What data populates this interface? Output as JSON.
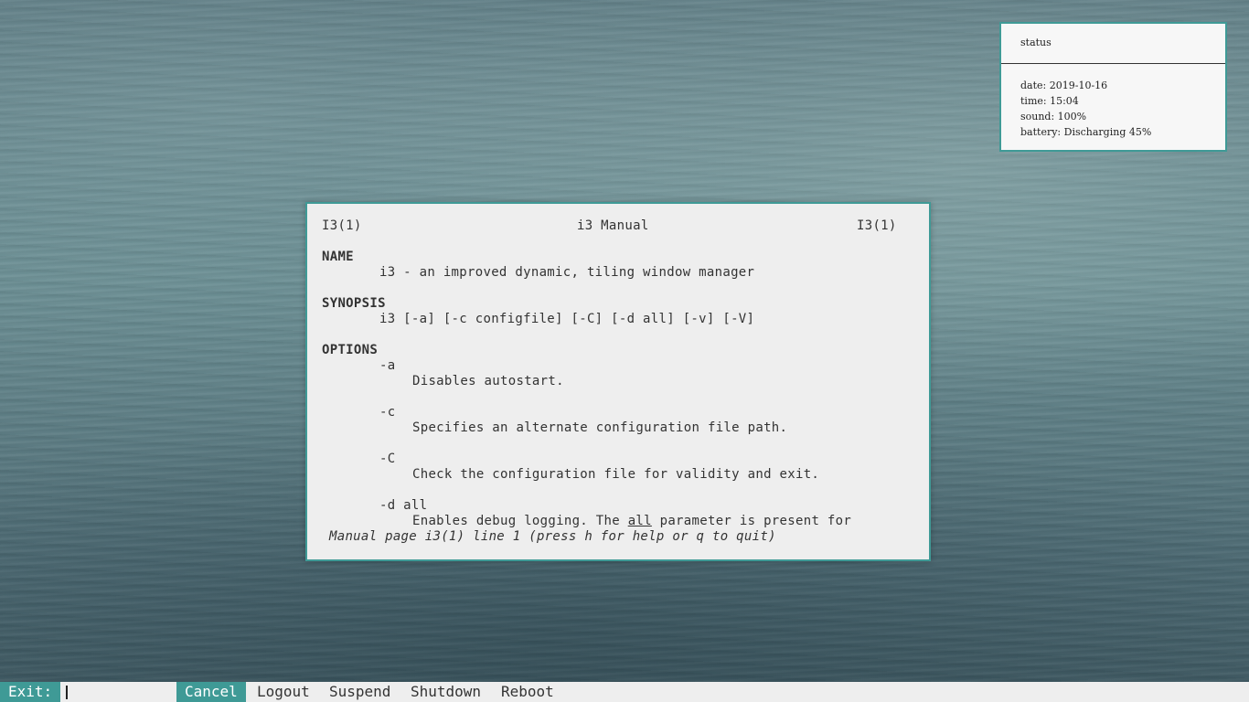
{
  "status": {
    "title": "status",
    "lines": [
      "date: 2019-10-16",
      "time: 15:04",
      "sound: 100%",
      "battery: Discharging 45%"
    ]
  },
  "manual": {
    "header_left": "I3(1)",
    "header_center": "i3 Manual",
    "header_right": "I3(1)",
    "name_heading": "NAME",
    "name_text": "i3 - an improved dynamic, tiling window manager",
    "synopsis_heading": "SYNOPSIS",
    "synopsis_text": "i3 [-a] [-c configfile] [-C] [-d all] [-v] [-V]",
    "options_heading": "OPTIONS",
    "options": [
      {
        "flag": "-a",
        "desc": "Disables autostart."
      },
      {
        "flag": "-c",
        "desc": "Specifies an alternate configuration file path."
      },
      {
        "flag": "-C",
        "desc": "Check the configuration file for validity and exit."
      },
      {
        "flag": "-d all"
      }
    ],
    "last_line_prefix": "Enables debug logging. The ",
    "last_line_underlined": "all",
    "last_line_suffix": " parameter is present for",
    "status_line": "Manual page i3(1) line 1 (press h for help or q to quit)"
  },
  "exit_bar": {
    "prompt": "Exit:",
    "input_value": "",
    "options": [
      "Cancel",
      "Logout",
      "Suspend",
      "Shutdown",
      "Reboot"
    ],
    "selected": "Cancel",
    "accent_color": "#3f9a96"
  }
}
